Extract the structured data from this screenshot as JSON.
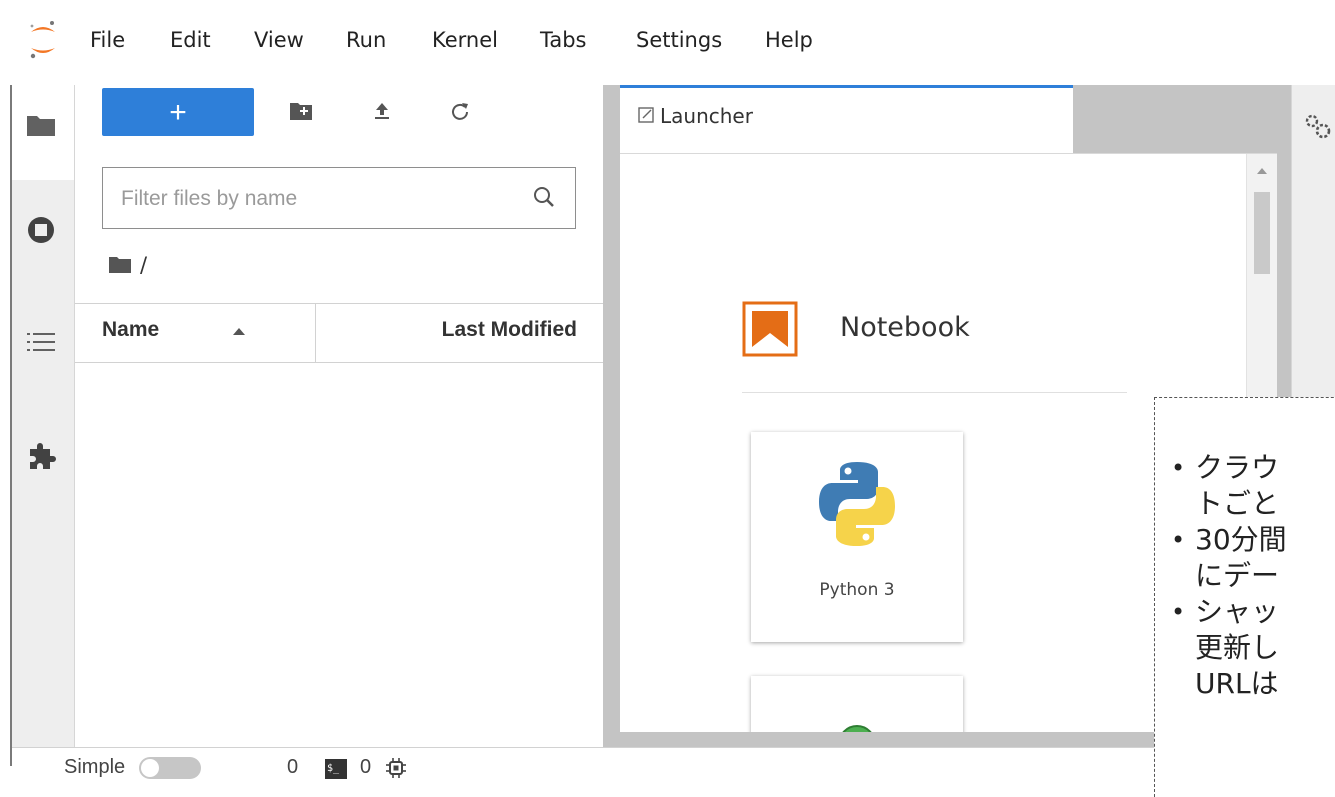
{
  "menubar": {
    "items": [
      "File",
      "Edit",
      "View",
      "Run",
      "Kernel",
      "Tabs",
      "Settings",
      "Help"
    ]
  },
  "filebrowser": {
    "new_button_label": "+",
    "filter_placeholder": "Filter files by name",
    "breadcrumb": "/",
    "columns": {
      "name": "Name",
      "last_modified": "Last Modified"
    }
  },
  "main": {
    "tab_label": "Launcher",
    "section_title": "Notebook",
    "kernel_card_label": "Python 3"
  },
  "statusbar": {
    "simple_label": "Simple",
    "kernels_count": "0",
    "terminal_label": "$_",
    "terminals_count": "0"
  },
  "callout": {
    "items": [
      {
        "line1": "クラウ",
        "line2": "トごと"
      },
      {
        "line1": "30分間",
        "line2": "にデー"
      },
      {
        "line1": "シャッ",
        "line2": "更新し",
        "line3": "URLは"
      }
    ]
  },
  "colors": {
    "accent": "#2e7fd9",
    "notebook_icon": "#e46d16",
    "python_blue": "#3f7cb4",
    "python_yellow": "#f6d34a",
    "green_kernel": "#4caf50"
  }
}
